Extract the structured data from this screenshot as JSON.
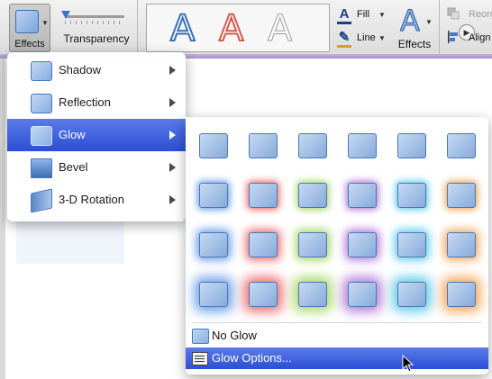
{
  "ribbon": {
    "effects_button": {
      "label": "Effects",
      "icon": "shape-effects-icon"
    },
    "transparency": {
      "label": "Transparency",
      "value_percent": 0
    },
    "wordart_styles": {
      "samples": [
        "A",
        "A",
        "A"
      ],
      "colors": [
        "#3a6fb5",
        "#d55a4a",
        "#9a9a9a"
      ]
    },
    "fill": {
      "label": "Fill"
    },
    "line": {
      "label": "Line"
    },
    "text_effects": {
      "label": "Effects",
      "glyph": "A"
    },
    "reorder": {
      "label": "Reord"
    },
    "align": {
      "label": "Align"
    }
  },
  "effects_menu": {
    "items": [
      {
        "label": "Shadow",
        "icon": "shadow-icon"
      },
      {
        "label": "Reflection",
        "icon": "reflection-icon"
      },
      {
        "label": "Glow",
        "icon": "glow-icon",
        "selected": true
      },
      {
        "label": "Bevel",
        "icon": "bevel-icon"
      },
      {
        "label": "3-D Rotation",
        "icon": "3d-rotation-icon"
      }
    ]
  },
  "glow_menu": {
    "rows": 4,
    "columns": 6,
    "colors": [
      "#6a9fe8",
      "#ec6b6b",
      "#a8d86a",
      "#b27ad8",
      "#5ecbe8",
      "#f2a65a"
    ],
    "no_glow_label": "No Glow",
    "options_label": "Glow Options..."
  },
  "colors": {
    "selection": "#2f55d9",
    "accent_strip": "#b79ad6"
  }
}
